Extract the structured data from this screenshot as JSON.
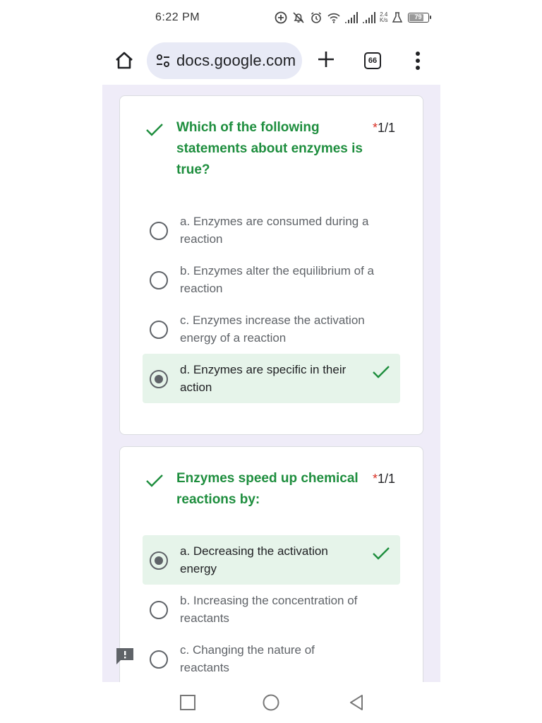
{
  "status_bar": {
    "time": "6:22 PM",
    "net_speed_value": "2.4",
    "net_speed_unit": "K/s",
    "battery_level": "79",
    "icons": [
      "add-circle-icon",
      "bell-off-icon",
      "alarm-icon",
      "wifi-icon",
      "signal-icon",
      "signal-icon",
      "net-speed",
      "lab-icon",
      "battery-icon"
    ]
  },
  "browser": {
    "url": "docs.google.com",
    "tab_count": "66",
    "icons": [
      "home-icon",
      "site-settings-icon",
      "new-tab-icon",
      "tab-switcher-icon",
      "menu-icon"
    ]
  },
  "questions": [
    {
      "title": "Which of the following statements about enzymes is true?",
      "required_mark": "*",
      "score": "1/1",
      "options": [
        {
          "label": "a. Enzymes are consumed during a reaction",
          "selected": false,
          "correct": false
        },
        {
          "label": "b. Enzymes alter the equilibrium of a reaction",
          "selected": false,
          "correct": false
        },
        {
          "label": "c. Enzymes increase the activation energy of a reaction",
          "selected": false,
          "correct": false
        },
        {
          "label": "d. Enzymes are specific in their action",
          "selected": true,
          "correct": true
        }
      ]
    },
    {
      "title": "Enzymes speed up chemical reactions by:",
      "required_mark": "*",
      "score": "1/1",
      "options": [
        {
          "label": "a. Decreasing the activation energy",
          "selected": true,
          "correct": true
        },
        {
          "label": "b. Increasing the concentration of reactants",
          "selected": false,
          "correct": false
        },
        {
          "label": "c. Changing the nature of reactants",
          "selected": false,
          "correct": false
        }
      ]
    }
  ],
  "colors": {
    "correct_green": "#1e8e3e",
    "correct_bg": "#e6f4ea",
    "required_red": "#d93025",
    "page_bg": "#efecf8",
    "url_bar_bg": "#e8eaf6"
  },
  "nav_bar": {
    "icons": [
      "recents-icon",
      "home-circle-icon",
      "back-icon"
    ]
  }
}
